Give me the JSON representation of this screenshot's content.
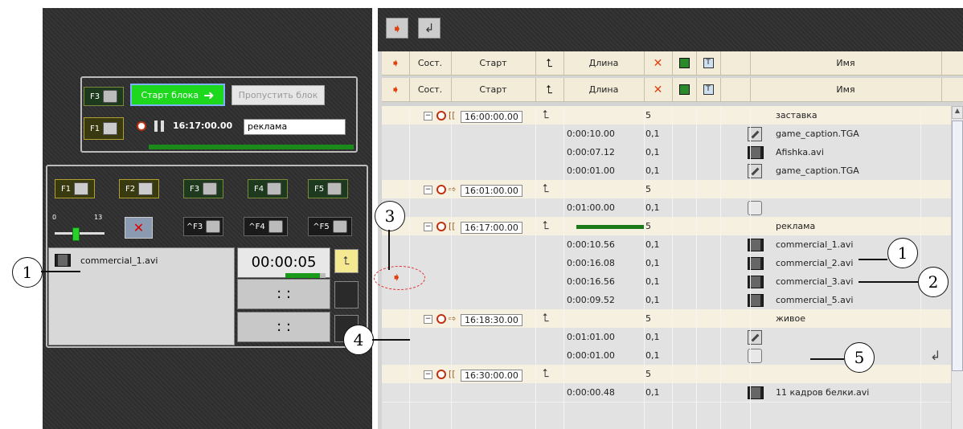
{
  "left": {
    "block_panel": {
      "f3_key": "F3",
      "start_block_label": "Старт блока",
      "skip_block_label": "Пропустить блок",
      "f1_key": "F1",
      "time": "16:17:00.00",
      "block_name": "реклама"
    },
    "fkeys_row1": [
      "F1",
      "F2",
      "F3",
      "F4",
      "F5"
    ],
    "slider": {
      "min": "0",
      "max": "13",
      "value_fraction": 0.4
    },
    "fkeys_row2": [
      "^F3",
      "^F4",
      "^F5"
    ],
    "current_clip": "commercial_1.avi",
    "timers": [
      "00:00:05",
      ": :",
      ": :"
    ],
    "progress_fraction": 0.85
  },
  "toolbar": {},
  "grid": {
    "headers": [
      "Сост.",
      "Старт",
      "Длина",
      "Имя"
    ],
    "rows": [
      {
        "kind": "block",
        "start": "16:00:00.00",
        "count": "5",
        "name": "заставка",
        "mode": "bracket"
      },
      {
        "kind": "item",
        "duration": "0:00:10.00",
        "val": "0,1",
        "icon": "brush",
        "name": "game_caption.TGA"
      },
      {
        "kind": "item",
        "duration": "0:00:07.12",
        "val": "0,1",
        "icon": "film",
        "name": "Afishka.avi"
      },
      {
        "kind": "item",
        "duration": "0:00:01.00",
        "val": "0,1",
        "icon": "brush",
        "name": "game_caption.TGA"
      },
      {
        "kind": "block",
        "start": "16:01:00.00",
        "count": "5",
        "name": "",
        "mode": "arrow"
      },
      {
        "kind": "item",
        "duration": "0:01:00.00",
        "val": "0,1",
        "icon": "cam",
        "name": ""
      },
      {
        "kind": "block",
        "start": "16:17:00.00",
        "count": "5",
        "name": "реклама",
        "mode": "bracket",
        "progress": true
      },
      {
        "kind": "item",
        "duration": "0:00:10.56",
        "val": "0,1",
        "icon": "film",
        "name": "commercial_1.avi"
      },
      {
        "kind": "item",
        "duration": "0:00:16.08",
        "val": "0,1",
        "icon": "film",
        "name": "commercial_2.avi",
        "current": true
      },
      {
        "kind": "item",
        "duration": "0:00:16.56",
        "val": "0,1",
        "icon": "film",
        "name": "commercial_3.avi"
      },
      {
        "kind": "item",
        "duration": "0:00:09.52",
        "val": "0,1",
        "icon": "film",
        "name": "commercial_5.avi"
      },
      {
        "kind": "block",
        "start": "16:18:30.00",
        "count": "5",
        "name": "живое",
        "mode": "arrow"
      },
      {
        "kind": "item",
        "duration": "0:01:01.00",
        "val": "0,1",
        "icon": "brush",
        "name": ""
      },
      {
        "kind": "item",
        "duration": "0:00:01.00",
        "val": "0,1",
        "icon": "cam",
        "name": "",
        "return": true
      },
      {
        "kind": "block",
        "start": "16:30:00.00",
        "count": "5",
        "name": "",
        "mode": "bracket"
      },
      {
        "kind": "item",
        "duration": "0:00:00.48",
        "val": "0,1",
        "icon": "film",
        "name": "11 кадров белки.avi"
      }
    ]
  },
  "callouts": [
    "1",
    "2",
    "3",
    "4",
    "5",
    "1"
  ]
}
